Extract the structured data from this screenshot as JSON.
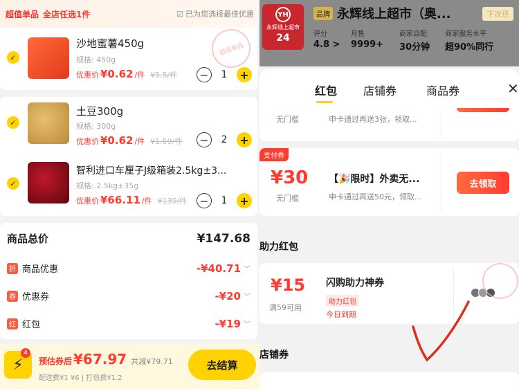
{
  "left": {
    "banner": {
      "label1": "超值单品",
      "label2": "全店任选1件",
      "hint": "已为您选择最佳优惠"
    },
    "items": [
      {
        "name": "沙地蜜薯450g",
        "spec": "规格: 450g",
        "price_prefix": "优惠价",
        "price": "¥0.62",
        "unit": "/件",
        "orig": "¥5.5/件",
        "qty": "1",
        "stamp": "超值单品"
      },
      {
        "name": "土豆300g",
        "spec": "规格: 300g",
        "price_prefix": "优惠价",
        "price": "¥0.62",
        "unit": "/件",
        "orig": "¥1.59/件",
        "qty": "2"
      },
      {
        "name": "智利进口车厘子J级箱装2.5kg±3...",
        "spec": "规格: 2.5kg±35g",
        "price_prefix": "优惠价",
        "price": "¥66.11",
        "unit": "/件",
        "orig": "¥139/件",
        "qty": "1"
      }
    ],
    "summary": {
      "total_label": "商品总价",
      "total_value": "¥147.68",
      "rows": [
        {
          "badge": "折",
          "label": "商品优惠",
          "value": "-¥40.71"
        },
        {
          "badge": "券",
          "label": "优惠券",
          "value": "-¥20"
        },
        {
          "badge": "红",
          "label": "红包",
          "value": "-¥19"
        }
      ]
    },
    "bottom": {
      "badge_count": "4",
      "est_label": "预估券后",
      "est_amount": "¥67.97",
      "saved": "共减¥79.71",
      "fees": "配送费¥1 ¥6 | 打包费¥1.2",
      "checkout": "去结算"
    }
  },
  "right": {
    "shop": {
      "logo": "YH",
      "logo_sub": "永辉线上超市",
      "logo_24": "24",
      "brand_tag": "品牌",
      "name": "永辉线上超市（奥...",
      "next_tag": "下次还",
      "stats": [
        {
          "k": "评分",
          "v": "4.8 >"
        },
        {
          "k": "月售",
          "v": "9999+"
        },
        {
          "k": "商家自配",
          "v": "30分钟"
        },
        {
          "k": "商家服务水平",
          "v": "超90%同行"
        }
      ]
    },
    "tabs": [
      "红包",
      "店铺券",
      "商品券"
    ],
    "coupons": [
      {
        "thr": "无门槛",
        "sub": "申卡通过再送3张，领取..."
      },
      {
        "paytag": "支付券",
        "amount": "¥30",
        "thr": "无门槛",
        "title": "【🎉限时】外卖无...",
        "sub": "申卡通过再送50元，领取...",
        "btn": "去领取"
      }
    ],
    "section_help": "助力红包",
    "help_coupon": {
      "amount": "¥15",
      "thr": "满59可用",
      "title": "闪购助力神券",
      "tag": "助力红包",
      "due": "今日到期"
    },
    "section_shop": "店铺券"
  },
  "colors": {
    "accent": "#ffd200",
    "price": "#ff3b30"
  }
}
